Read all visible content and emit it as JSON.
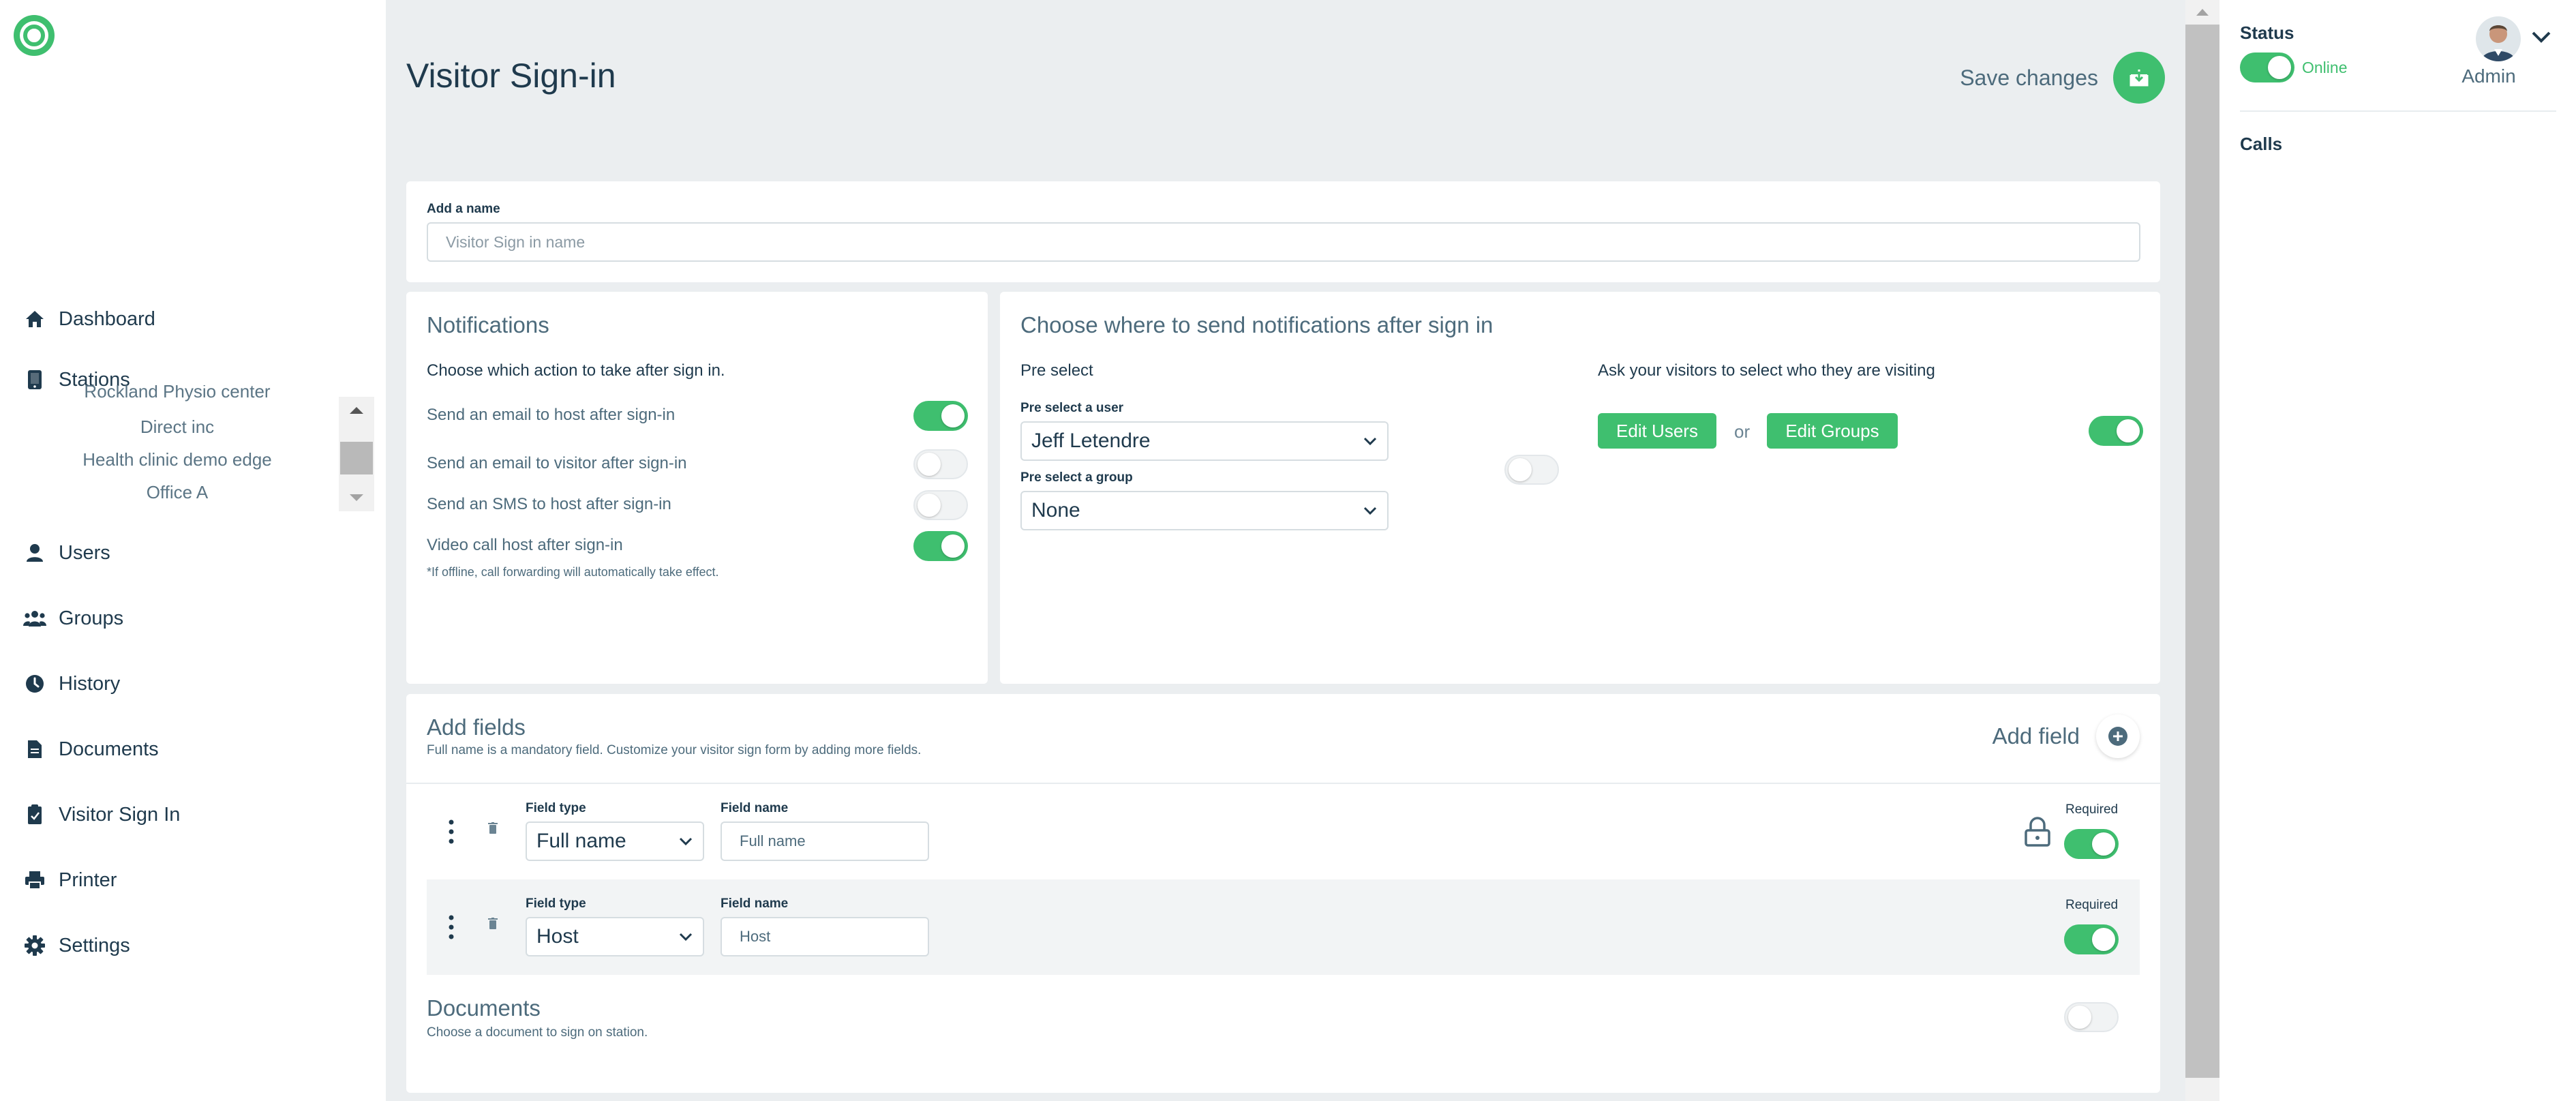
{
  "sidebar": {
    "nav": [
      {
        "label": "Dashboard",
        "icon": "home-icon"
      },
      {
        "label": "Stations",
        "icon": "tablet-icon"
      },
      {
        "label": "Users",
        "icon": "user-icon"
      },
      {
        "label": "Groups",
        "icon": "users-icon"
      },
      {
        "label": "History",
        "icon": "clock-icon"
      },
      {
        "label": "Documents",
        "icon": "document-icon"
      },
      {
        "label": "Visitor Sign In",
        "icon": "clipboard-check-icon"
      },
      {
        "label": "Printer",
        "icon": "printer-icon"
      },
      {
        "label": "Settings",
        "icon": "gear-icon"
      }
    ],
    "stations": [
      "Rockland Physio center",
      "Direct inc",
      "Health clinic demo edge",
      "Office A"
    ]
  },
  "header": {
    "title": "Visitor Sign-in",
    "save_label": "Save changes"
  },
  "name_card": {
    "label": "Add a name",
    "placeholder": "Visitor Sign in name"
  },
  "notifications": {
    "title": "Notifications",
    "subtitle": "Choose which action to take after sign in.",
    "items": [
      {
        "label": "Send an email to host after sign-in",
        "enabled": true
      },
      {
        "label": "Send an email to visitor after sign-in",
        "enabled": false
      },
      {
        "label": "Send an SMS to host after sign-in",
        "enabled": false
      },
      {
        "label": "Video call host after sign-in",
        "enabled": true
      }
    ],
    "note": "*If offline, call forwarding will automatically take effect."
  },
  "destination": {
    "title": "Choose where to send notifications after sign in",
    "preselect_heading": "Pre select",
    "preselect_user_label": "Pre select a user",
    "preselect_user_value": "Jeff Letendre",
    "preselect_group_label": "Pre select a group",
    "preselect_group_value": "None",
    "preselect_toggle": false,
    "ask_heading": "Ask your visitors to select who they are visiting",
    "edit_users_label": "Edit Users",
    "or_label": "or",
    "edit_groups_label": "Edit Groups",
    "ask_toggle": true
  },
  "fields": {
    "title": "Add fields",
    "subtitle": "Full name is a mandatory field. Customize your visitor sign form by adding more fields.",
    "add_label": "Add field",
    "field_type_label": "Field type",
    "field_name_label": "Field name",
    "required_label": "Required",
    "rows": [
      {
        "type": "Full name",
        "name": "Full name",
        "required": true,
        "locked": true
      },
      {
        "type": "Host",
        "name": "Host",
        "required": true,
        "locked": false
      }
    ]
  },
  "documents": {
    "title": "Documents",
    "subtitle": "Choose a document to sign on station.",
    "enabled": false
  },
  "right_panel": {
    "status_label": "Status",
    "status_value": "Online",
    "user_role": "Admin",
    "calls_label": "Calls"
  },
  "colors": {
    "accent": "#3fbf6f",
    "text_primary": "#1f3a4d",
    "text_secondary": "#4d6b7c",
    "background": "#ebeef0"
  }
}
